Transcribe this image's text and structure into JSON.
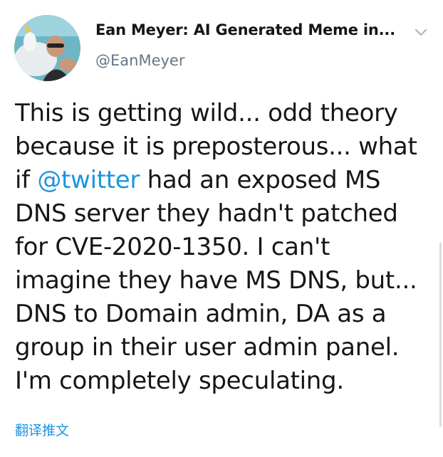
{
  "author": {
    "display_name": "Ean Meyer: AI Generated Meme in...",
    "handle": "@EanMeyer"
  },
  "tweet": {
    "lines": [
      {
        "pre": "This is getting wild... odd theory",
        "mention": "",
        "post": ""
      },
      {
        "pre": "because it is preposterous... what",
        "mention": "",
        "post": ""
      },
      {
        "pre": "if ",
        "mention": "@twitter",
        "post": " had an exposed MS"
      },
      {
        "pre": "DNS server they hadn't patched",
        "mention": "",
        "post": ""
      },
      {
        "pre": "for CVE-2020-1350. I can't",
        "mention": "",
        "post": ""
      },
      {
        "pre": "imagine they have MS DNS, but...",
        "mention": "",
        "post": ""
      },
      {
        "pre": "DNS to Domain admin, DA as a",
        "mention": "",
        "post": ""
      },
      {
        "pre": "group in their user admin panel.",
        "mention": "",
        "post": ""
      },
      {
        "pre": "I'm completely speculating.",
        "mention": "",
        "post": ""
      }
    ]
  },
  "translate_label": "翻译推文",
  "icons": {
    "menu": "chevron-down-icon",
    "avatar": "avatar"
  },
  "colors": {
    "link": "#1b95e0",
    "text": "#14171a",
    "secondary": "#657786"
  }
}
